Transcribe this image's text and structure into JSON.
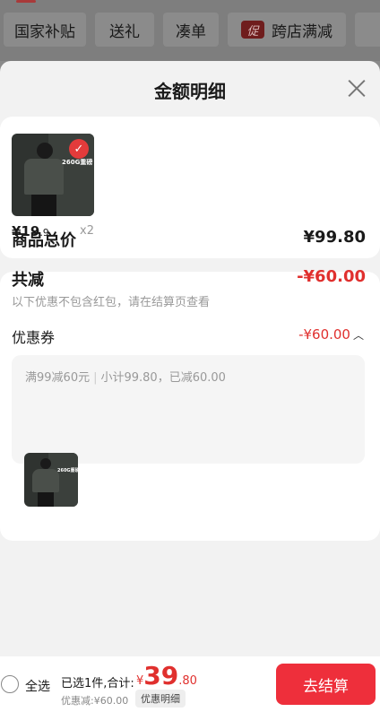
{
  "filters": [
    "国家补贴",
    "送礼",
    "凑单",
    "跨店满减"
  ],
  "filters_promo_tag": "促",
  "sheet": {
    "title": "金额明细"
  },
  "product": {
    "image_text": "260G重磅",
    "price_int": "¥19",
    "price_dec": ".9",
    "quantity": "x2"
  },
  "summary": {
    "total_label": "商品总价",
    "total_value": "¥99.80",
    "reduce_label": "共减",
    "reduce_value": "-¥60.00",
    "reduce_note": "以下优惠不包含红包，请在结算页查看",
    "coupon_label": "优惠券",
    "coupon_value": "-¥60.00",
    "coupon_rule": "满99减60元",
    "coupon_subtotal": "小计99.80，已减60.00"
  },
  "bottom": {
    "select_all": "全选",
    "selected_text": "已选1件,合计:",
    "currency": "¥",
    "total_int": "39",
    "total_dec": ".80",
    "saved_text": "优惠减:¥60.00",
    "detail_label": "优惠明细",
    "checkout_label": "去结算"
  },
  "colors": {
    "accent_red": "#e0302e",
    "checkout_red": "#ee2f3b"
  },
  "icons": {
    "close": "close-icon",
    "caret": "chevron-up-icon",
    "checkbox": "radio-circle-icon"
  }
}
